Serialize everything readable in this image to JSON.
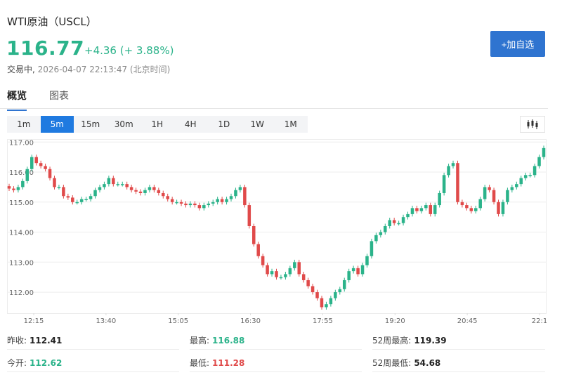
{
  "header": {
    "title": "WTI原油（USCL）",
    "price": "116.77",
    "change": "+4.36 (+ 3.88%)",
    "status": "交易中,",
    "timestamp": "2026-04-07 22:13:47 (北京时间)",
    "add_button": "+加自选"
  },
  "tabs": [
    {
      "label": "概览",
      "active": true
    },
    {
      "label": "图表",
      "active": false
    }
  ],
  "ranges": [
    {
      "label": "1m",
      "active": false
    },
    {
      "label": "5m",
      "active": true
    },
    {
      "label": "15m",
      "active": false
    },
    {
      "label": "30m",
      "active": false
    },
    {
      "label": "1H",
      "active": false
    },
    {
      "label": "4H",
      "active": false
    },
    {
      "label": "1D",
      "active": false
    },
    {
      "label": "1W",
      "active": false
    },
    {
      "label": "1M",
      "active": false
    }
  ],
  "chart_toggle_icon": "candlestick-icon",
  "colors": {
    "up": "#2bb38a",
    "down": "#e04a4a",
    "accent": "#1f7ae0"
  },
  "chart_data": {
    "type": "candlestick",
    "y_ticks": [
      "112.00",
      "113.00",
      "114.00",
      "115.00",
      "116.00",
      "117.00"
    ],
    "x_ticks": [
      "12:15",
      "13:40",
      "15:05",
      "16:30",
      "17:55",
      "19:20",
      "20:45",
      "22:1"
    ],
    "ylim": [
      111.3,
      117.1
    ],
    "grid": true,
    "closes": [
      115.45,
      115.4,
      115.5,
      115.7,
      116.1,
      116.5,
      116.3,
      116.2,
      116.1,
      115.8,
      115.5,
      115.5,
      115.2,
      115.15,
      115.0,
      115.0,
      115.1,
      115.1,
      115.2,
      115.4,
      115.5,
      115.6,
      115.8,
      115.6,
      115.6,
      115.6,
      115.5,
      115.4,
      115.35,
      115.3,
      115.4,
      115.5,
      115.4,
      115.3,
      115.2,
      115.1,
      115.0,
      115.0,
      114.95,
      114.9,
      114.95,
      114.9,
      114.8,
      114.9,
      114.95,
      115.0,
      115.1,
      115.0,
      115.1,
      115.2,
      115.4,
      115.5,
      114.9,
      114.2,
      113.6,
      113.2,
      112.9,
      112.6,
      112.7,
      112.5,
      112.5,
      112.6,
      112.8,
      113.0,
      112.6,
      112.4,
      112.2,
      112.0,
      111.8,
      111.5,
      111.6,
      111.8,
      112.0,
      112.1,
      112.4,
      112.7,
      112.8,
      112.6,
      112.9,
      113.2,
      113.7,
      113.9,
      114.0,
      114.2,
      114.4,
      114.3,
      114.3,
      114.5,
      114.6,
      114.8,
      114.7,
      114.8,
      114.9,
      114.6,
      114.9,
      115.3,
      115.9,
      116.2,
      116.3,
      115.0,
      114.9,
      114.8,
      114.7,
      114.8,
      115.1,
      115.5,
      115.4,
      115.0,
      114.6,
      115.0,
      115.4,
      115.5,
      115.6,
      115.8,
      115.9,
      115.9,
      116.2,
      116.5,
      116.8
    ]
  },
  "stats": {
    "prev_close_label": "昨收:",
    "prev_close": "112.41",
    "open_label": "今开:",
    "open": "112.62",
    "high_label": "最高:",
    "high": "116.88",
    "low_label": "最低:",
    "low": "111.28",
    "w52_high_label": "52周最高:",
    "w52_high": "119.39",
    "w52_low_label": "52周最低:",
    "w52_low": "54.68"
  }
}
